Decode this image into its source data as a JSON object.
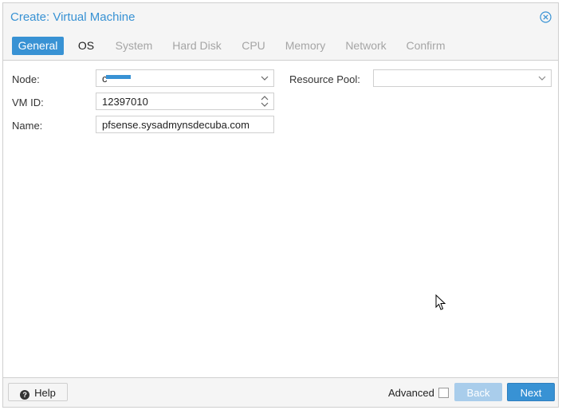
{
  "window": {
    "title": "Create: Virtual Machine"
  },
  "tabs": [
    {
      "label": "General",
      "state": "active"
    },
    {
      "label": "OS",
      "state": "enabled"
    },
    {
      "label": "System",
      "state": "disabled"
    },
    {
      "label": "Hard Disk",
      "state": "disabled"
    },
    {
      "label": "CPU",
      "state": "disabled"
    },
    {
      "label": "Memory",
      "state": "disabled"
    },
    {
      "label": "Network",
      "state": "disabled"
    },
    {
      "label": "Confirm",
      "state": "disabled"
    }
  ],
  "form": {
    "node": {
      "label": "Node:",
      "value": "c"
    },
    "vmid": {
      "label": "VM ID:",
      "value": "12397010"
    },
    "name": {
      "label": "Name:",
      "value": "pfsense.sysadmynsdecuba.com"
    },
    "pool": {
      "label": "Resource Pool:",
      "value": ""
    }
  },
  "footer": {
    "help_label": "Help",
    "advanced_label": "Advanced",
    "advanced_checked": false,
    "back_label": "Back",
    "next_label": "Next"
  },
  "icons": {
    "close": "close-circle-icon",
    "help": "question-circle-icon",
    "dropdown": "chevron-down-icon",
    "spinner": "spinner-arrows-icon"
  },
  "colors": {
    "accent": "#3892d4",
    "disabled_button": "#a9cdeb",
    "tab_disabled_text": "#a5a5a5"
  }
}
